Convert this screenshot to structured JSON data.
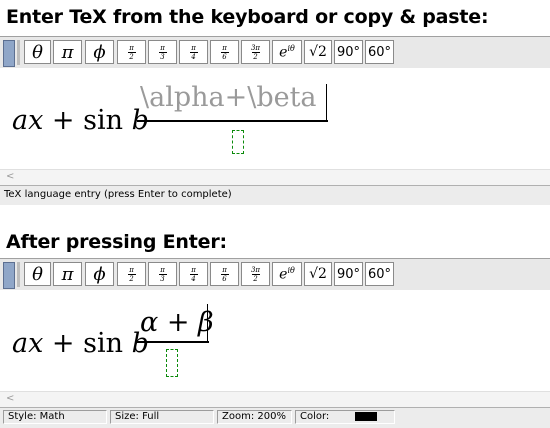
{
  "headings": {
    "top": "Enter TeX from the keyboard or copy & paste:",
    "bottom": "After pressing Enter:"
  },
  "toolbar": {
    "buttons": [
      {
        "kind": "symbol",
        "label": "θ",
        "icon": "theta-icon"
      },
      {
        "kind": "symbol",
        "label": "π",
        "icon": "pi-icon"
      },
      {
        "kind": "symbol",
        "label": "ϕ",
        "icon": "phi-icon"
      },
      {
        "kind": "fraction",
        "num": "π",
        "den": "2",
        "icon": "pi-over-2-icon"
      },
      {
        "kind": "fraction",
        "num": "π",
        "den": "3",
        "icon": "pi-over-3-icon"
      },
      {
        "kind": "fraction",
        "num": "π",
        "den": "4",
        "icon": "pi-over-4-icon"
      },
      {
        "kind": "fraction",
        "num": "π",
        "den": "6",
        "icon": "pi-over-6-icon"
      },
      {
        "kind": "fraction",
        "num": "3π",
        "den": "2",
        "icon": "three-pi-over-2-icon"
      },
      {
        "kind": "symbol",
        "label": "e",
        "sup": "iθ",
        "icon": "e-to-i-theta-icon"
      },
      {
        "kind": "symbol",
        "label": "√2",
        "icon": "sqrt-2-icon"
      },
      {
        "kind": "text",
        "label": "90°",
        "icon": "ninety-degrees-icon"
      },
      {
        "kind": "text",
        "label": "60°",
        "icon": "sixty-degrees-icon"
      }
    ]
  },
  "editor_top": {
    "expression_prefix": "ax + sin b",
    "tex_input": "\\alpha+\\beta"
  },
  "editor_bottom": {
    "expression_prefix": "ax + sin b",
    "numerator": "α + β"
  },
  "scroll_arrow": "<",
  "status_top": {
    "message": "TeX language entry (press Enter to complete)"
  },
  "status_bottom": {
    "style": "Style: Math",
    "size": "Size: Full",
    "zoom": "Zoom: 200%",
    "color_label": "Color:",
    "color_value": "#000000"
  }
}
